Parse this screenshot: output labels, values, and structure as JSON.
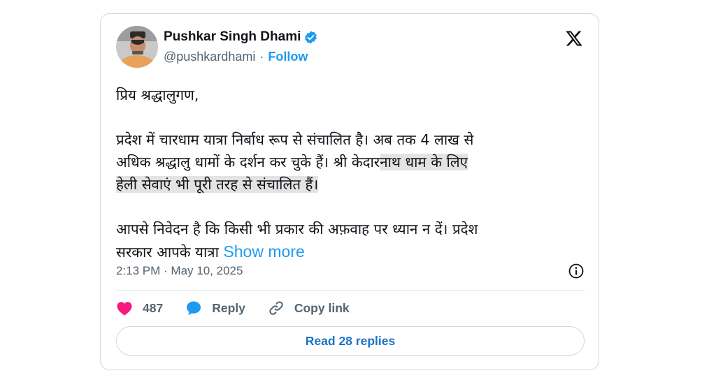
{
  "author": {
    "name": "Pushkar Singh Dhami",
    "handle": "@pushkardhami",
    "separator": "·",
    "follow_label": "Follow"
  },
  "tweet": {
    "greeting": "प्रिय श्रद्धालुगण,",
    "para2_line1": "प्रदेश में चारधाम यात्रा निर्बाध रूप से संचालित है। अब तक 4 लाख से",
    "para2_line2_plain": "अधिक श्रद्धालु धामों के दर्शन कर चुके हैं। श्री केदार",
    "para2_line2_highlight": "नाथ धाम के लिए",
    "para2_line3_highlight": "हेली सेवाएं भी पूरी तरह से संचालित हैं।",
    "para3_line1": "आपसे निवेदन है कि किसी भी प्रकार की अफ़वाह पर ध्यान न दें। प्रदेश",
    "para3_line2": "सरकार आपके यात्रा ",
    "show_more": "Show more"
  },
  "meta": {
    "timestamp": "2:13 PM · May 10, 2025"
  },
  "actions": {
    "likes": "487",
    "reply_label": "Reply",
    "copy_link_label": "Copy link"
  },
  "read_replies_label": "Read 28 replies",
  "icons": {
    "verified": "verified-badge-icon",
    "x_logo": "x-logo-icon",
    "info": "info-icon",
    "heart": "heart-icon",
    "reply": "reply-bubble-icon",
    "link": "link-icon"
  },
  "colors": {
    "accent": "#1d9bf0",
    "like": "#f91880",
    "text": "#0f1419",
    "muted": "#536471"
  }
}
